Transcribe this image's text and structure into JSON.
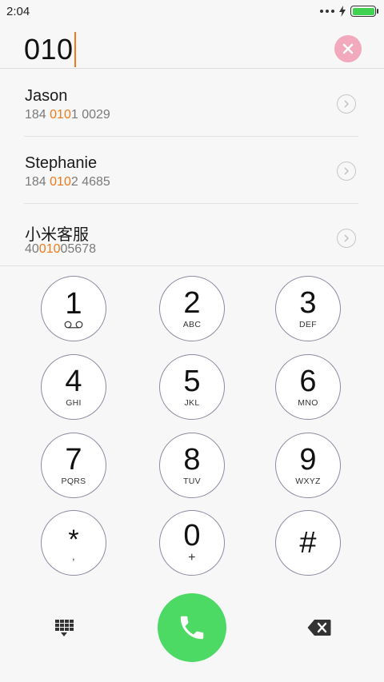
{
  "status_bar": {
    "time": "2:04",
    "battery_color": "#3fd14f"
  },
  "dial_input": {
    "value": "010",
    "cursor_color": "#f07a1b"
  },
  "clear_button": {
    "icon": "close-icon",
    "color": "#f2a9bd"
  },
  "contacts": [
    {
      "name": "Jason",
      "number_parts": [
        "184 ",
        "010",
        "1 0029"
      ]
    },
    {
      "name": "Stephanie",
      "number_parts": [
        "184 ",
        "010",
        "2 4685"
      ]
    },
    {
      "name": "小米客服",
      "number_parts": [
        "40",
        "010",
        "05678"
      ]
    }
  ],
  "highlight_color": "#f07a1b",
  "keypad": {
    "keys": [
      {
        "digit": "1",
        "sub": "voicemail-icon"
      },
      {
        "digit": "2",
        "sub": "ABC"
      },
      {
        "digit": "3",
        "sub": "DEF"
      },
      {
        "digit": "4",
        "sub": "GHI"
      },
      {
        "digit": "5",
        "sub": "JKL"
      },
      {
        "digit": "6",
        "sub": "MNO"
      },
      {
        "digit": "7",
        "sub": "PQRS"
      },
      {
        "digit": "8",
        "sub": "TUV"
      },
      {
        "digit": "9",
        "sub": "WXYZ"
      },
      {
        "digit": "*",
        "sub": ","
      },
      {
        "digit": "0",
        "sub": "+"
      },
      {
        "digit": "#",
        "sub": ""
      }
    ]
  },
  "bottom_bar": {
    "left_icon": "dialpad-grid-icon",
    "call_icon": "phone-icon",
    "call_color": "#4cd964",
    "right_icon": "backspace-icon"
  }
}
